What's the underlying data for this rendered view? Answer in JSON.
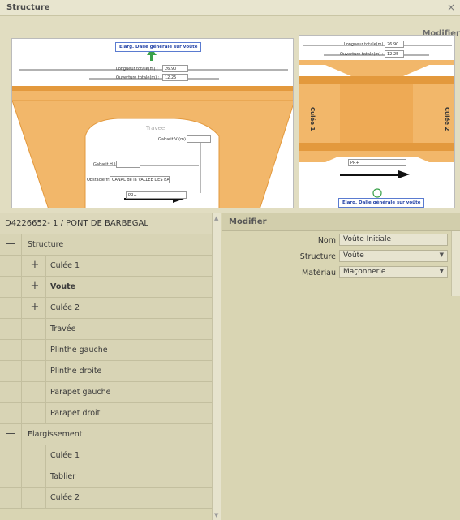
{
  "window": {
    "title": "Structure",
    "close_glyph": "×"
  },
  "drawing": {
    "modify_link": "Modifier",
    "left_view": {
      "elarg_button": "Elarg. Dalle générale sur voûte",
      "longueur_label": "Longueur totale(m) :",
      "longueur_value": "26.90",
      "ouverture_label": "Ouverture totale(m) :",
      "ouverture_value": "12.25",
      "travee_label": "Travee",
      "gabarit_v_label": "Gabarit V (m)",
      "gabarit_h_label": "Gabarit H (m)",
      "obstacle_label": "Obstacle franchi",
      "obstacle_value": "CANAL de la VALLEE DES BA",
      "pr_value": "PR+"
    },
    "right_view": {
      "longueur_label": "Longueur totale(m) :",
      "longueur_value": "26.90",
      "ouverture_label": "Ouverture totale(m) :",
      "ouverture_value": "12.25",
      "culee1_label": "Culée 1",
      "culee2_label": "Culée 2",
      "pr_value": "PR+",
      "elarg_button": "Elarg. Dalle générale sur voûte"
    }
  },
  "tree": {
    "header": "D4226652- 1 / PONT DE BARBEGAL",
    "items": [
      {
        "label": "Structure",
        "toggle": "—",
        "level": 0
      },
      {
        "label": "Culée 1",
        "toggle": "+",
        "level": 1
      },
      {
        "label": "Voute",
        "toggle": "+",
        "level": 1,
        "selected": true
      },
      {
        "label": "Culée 2",
        "toggle": "+",
        "level": 1
      },
      {
        "label": "Travée",
        "toggle": "",
        "level": 2
      },
      {
        "label": "Plinthe gauche",
        "toggle": "",
        "level": 2
      },
      {
        "label": "Plinthe droite",
        "toggle": "",
        "level": 2
      },
      {
        "label": "Parapet gauche",
        "toggle": "",
        "level": 2
      },
      {
        "label": "Parapet droit",
        "toggle": "",
        "level": 2
      },
      {
        "label": "Elargissement",
        "toggle": "—",
        "level": 0
      },
      {
        "label": "Culée 1",
        "toggle": "",
        "level": 2
      },
      {
        "label": "Tablier",
        "toggle": "",
        "level": 2
      },
      {
        "label": "Culée 2",
        "toggle": "",
        "level": 2
      }
    ]
  },
  "modify": {
    "header": "Modifier",
    "nom_label": "Nom",
    "nom_value": "Voûte Initiale",
    "structure_label": "Structure",
    "structure_value": "Voûte",
    "materiau_label": "Matériau",
    "materiau_value": "Maçonnerie"
  },
  "colors": {
    "bridge_orange": "#f2b76a",
    "bridge_dark": "#e3993d",
    "panel_bg": "#d9d5b3",
    "link_blue": "#2645a8"
  }
}
